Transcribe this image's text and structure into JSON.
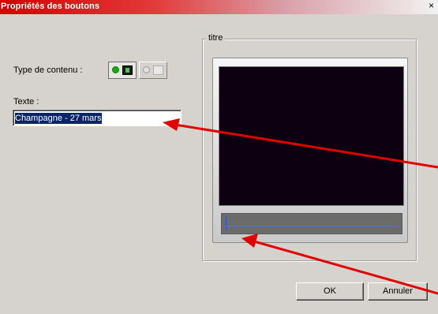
{
  "window": {
    "title": "Propriétés des boutons",
    "close_label": "×"
  },
  "content_type": {
    "label": "Type de contenu :",
    "options": [
      "video",
      "image"
    ],
    "selected": "video"
  },
  "text": {
    "label": "Texte :",
    "value": "Champagne -  27 mars"
  },
  "preview_group": {
    "legend": "titre"
  },
  "buttons": {
    "ok": "OK",
    "cancel": "Annuler"
  },
  "annotation_color": "#e00000"
}
